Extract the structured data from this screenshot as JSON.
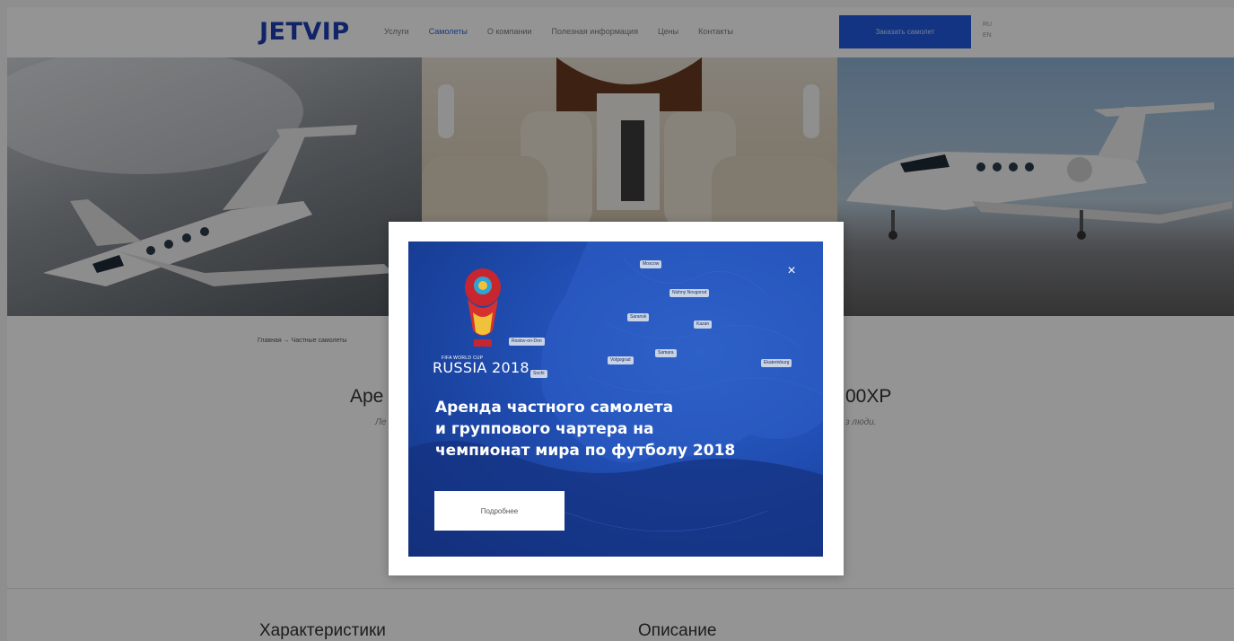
{
  "header": {
    "logo": "JETVIP",
    "nav": [
      "Услуги",
      "Самолеты",
      "О компании",
      "Полезная информация",
      "Цены",
      "Контакты"
    ],
    "order_button": "Заказать самолет",
    "lang": [
      "RU",
      "EN"
    ]
  },
  "breadcrumb": "Главная → Частные самолеты",
  "jet": {
    "title_left": "Аре",
    "title_right": "00XP",
    "subtitle_left": "Ле",
    "subtitle_right": "з люди."
  },
  "sections": {
    "characteristics": "Характеристики",
    "description": "Описание"
  },
  "modal": {
    "close_icon": "×",
    "fifa_line": "FIFA WORLD CUP",
    "russia": "RUSSIA 2018",
    "headline": [
      "Аренда частного самолета",
      "и группового чартера на",
      "чемпионат мира по футболу 2018"
    ],
    "button": "Подробнее",
    "cities": [
      "Moscow",
      "Nizhny Novgorod",
      "Saransk",
      "Kazan",
      "Rostov-on-Don",
      "Volgograd",
      "Samara",
      "Sochi",
      "Ekaterinburg"
    ]
  },
  "colors": {
    "brand": "#1e3fb4",
    "button_blue": "#1f5be0",
    "promo_blue": "#214fb4"
  }
}
